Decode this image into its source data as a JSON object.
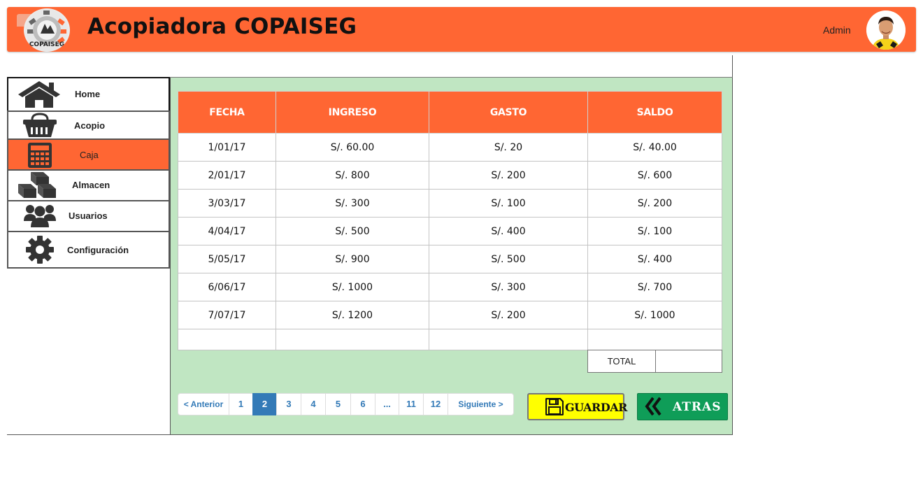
{
  "header": {
    "title": "Acopiadora COPAISEG",
    "logo_text": "COPAISEG",
    "user_label": "Admin",
    "accent_color": "#ff6633"
  },
  "sidebar": {
    "items": [
      {
        "label": "Home",
        "icon": "home-icon"
      },
      {
        "label": "Acopio",
        "icon": "basket-icon"
      },
      {
        "label": "Caja",
        "icon": "calculator-icon",
        "selected": true
      },
      {
        "label": "Almacen",
        "icon": "boxes-icon"
      },
      {
        "label": "Usuarios",
        "icon": "users-icon"
      },
      {
        "label": "Configuración",
        "icon": "gear-icon"
      }
    ]
  },
  "table": {
    "headers": [
      "FECHA",
      "INGRESO",
      "GASTO",
      "SALDO"
    ],
    "rows": [
      [
        "1/01/17",
        "S/. 60.00",
        "S/. 20",
        "S/. 40.00"
      ],
      [
        "2/01/17",
        "S/. 800",
        "S/. 200",
        "S/. 600"
      ],
      [
        "3/03/17",
        "S/. 300",
        "S/. 100",
        "S/. 200"
      ],
      [
        "4/04/17",
        "S/. 500",
        "S/. 400",
        "S/. 100"
      ],
      [
        "5/05/17",
        "S/. 900",
        "S/. 500",
        "S/. 400"
      ],
      [
        "6/06/17",
        "S/. 1000",
        "S/. 300",
        "S/. 700"
      ],
      [
        "7/07/17",
        "S/. 1200",
        "S/. 200",
        "S/. 1000"
      ]
    ],
    "total_label": "TOTAL",
    "total_value": ""
  },
  "pagination": {
    "prev": "< Anterior",
    "pages": [
      "1",
      "2",
      "3",
      "4",
      "5",
      "6",
      "...",
      "11",
      "12"
    ],
    "active": "2",
    "next": "Siguiente >"
  },
  "actions": {
    "save_label": "GUARDAR",
    "save_color": "#ffff00",
    "back_label": "ATRAS",
    "back_color": "#0f9d58"
  }
}
